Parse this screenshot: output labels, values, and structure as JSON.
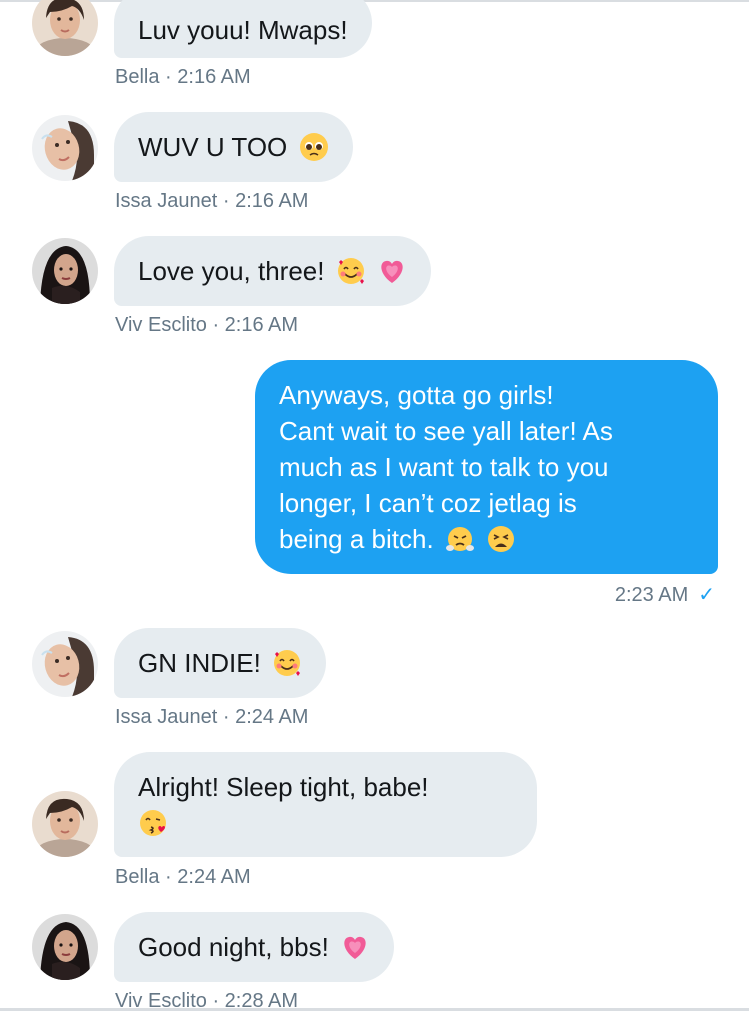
{
  "conversation": {
    "messages": [
      {
        "id": "m0",
        "direction": "incoming",
        "sender": "Bella",
        "time": "2:16 AM",
        "text": "Luv youu! Mwaps!",
        "emojis": []
      },
      {
        "id": "m1",
        "direction": "incoming",
        "sender": "Issa Jaunet",
        "time": "2:16 AM",
        "text": "WUV U TOO",
        "emojis": [
          "pleading-face"
        ]
      },
      {
        "id": "m2",
        "direction": "incoming",
        "sender": "Viv Esclito",
        "time": "2:16 AM",
        "text": "Love you, three!",
        "emojis": [
          "smiling-face-with-hearts",
          "growing-heart"
        ]
      },
      {
        "id": "m3",
        "direction": "outgoing",
        "time": "2:23 AM",
        "status_icon": "check-icon",
        "lines": [
          "Anyways, gotta go girls!",
          "Cant wait to see yall later! As",
          "much as I want to talk to you",
          "longer, I can’t coz jetlag is",
          "being a bitch."
        ],
        "emojis": [
          "face-with-steam",
          "weary-face"
        ]
      },
      {
        "id": "m4",
        "direction": "incoming",
        "sender": "Issa Jaunet",
        "time": "2:24 AM",
        "text": "GN INDIE!",
        "emojis": [
          "smiling-face-with-hearts"
        ]
      },
      {
        "id": "m5",
        "direction": "incoming",
        "sender": "Bella",
        "time": "2:24 AM",
        "text": "Alright! Sleep tight, babe!",
        "emojis": [
          "face-blowing-kiss"
        ]
      },
      {
        "id": "m6",
        "direction": "incoming",
        "sender": "Viv Esclito",
        "time": "2:28 AM",
        "text": "Good night, bbs!",
        "emojis": [
          "growing-heart"
        ]
      }
    ],
    "colors": {
      "incoming_bubble": "#e6ecf0",
      "outgoing_bubble": "#1da1f2",
      "meta_text": "#657786",
      "read_check": "#1da1f2"
    }
  }
}
